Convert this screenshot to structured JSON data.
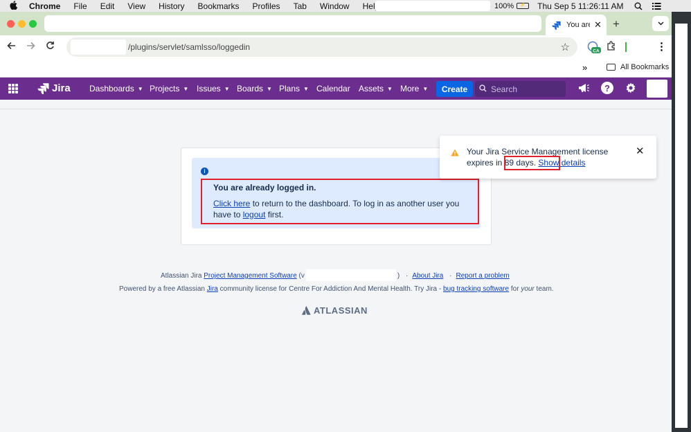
{
  "menubar": {
    "app_name": "Chrome",
    "items": [
      "File",
      "Edit",
      "View",
      "History",
      "Bookmarks",
      "Profiles",
      "Tab",
      "Window",
      "Help"
    ],
    "battery": "100%",
    "datetime": "Thu Sep 5  11:26:11 AM"
  },
  "browser": {
    "tab_title": "You are",
    "url": "/plugins/servlet/samlsso/loggedin",
    "bookmarks_label": "All Bookmarks",
    "profile_badge": "CA"
  },
  "jira_nav": {
    "logo_text": "Jira",
    "items": [
      "Dashboards",
      "Projects",
      "Issues",
      "Boards",
      "Plans",
      "Calendar",
      "Assets",
      "More"
    ],
    "create_label": "Create",
    "search_placeholder": "Search",
    "help_glyph": "?"
  },
  "notice": {
    "title": "You are already logged in.",
    "link_click_here": "Click here",
    "text_mid": " to return to the dashboard. To log in as another user you have to ",
    "link_logout": "logout",
    "text_end": " first."
  },
  "footer": {
    "line1_prefix": "Atlassian Jira ",
    "line1_link": "Project Management Software",
    "line1_version_open": " (v",
    "line1_version_close": ")",
    "sep": "·",
    "about_link": "About Jira",
    "report_link": "Report a problem",
    "line2_prefix": "Powered by a free Atlassian ",
    "line2_jira_link": "Jira",
    "line2_mid": " community license for Centre For Addiction And Mental Health. Try Jira - ",
    "line2_bug_link": "bug tracking software",
    "line2_for": " for ",
    "line2_your": "your",
    "line2_end": " team.",
    "brand": "ATLASSIAN"
  },
  "flag": {
    "message": "Your Jira Service Management license expires in 89 days.",
    "link": "Show details"
  },
  "colors": {
    "jira_nav_bg": "#6b2e8f",
    "create_btn": "#0b66e4",
    "info_bg": "#deebff",
    "highlight_frame": "#e0202a",
    "warning": "#f5a623"
  }
}
